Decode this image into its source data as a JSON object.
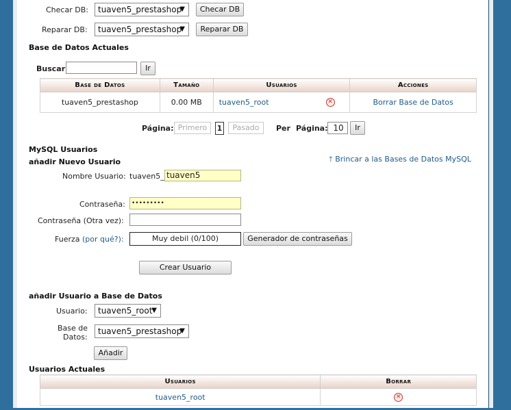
{
  "check_db": {
    "label": "Checar DB:",
    "selected": "tuaven5_prestashop",
    "button": "Checar DB"
  },
  "repair_db": {
    "label": "Reparar DB:",
    "selected": "tuaven5_prestashop",
    "button": "Reparar DB"
  },
  "current_dbs": {
    "title": "Base de Datos Actuales",
    "search_label": "Buscar",
    "search_value": "",
    "search_button": "Ir",
    "columns": [
      "Base de Datos",
      "Tamaño",
      "Usuarios",
      "Acciones"
    ],
    "rows": [
      {
        "name": "tuaven5_prestashop",
        "size": "0.00 MB",
        "user": "tuaven5_root",
        "action": "Borrar Base de Datos"
      }
    ]
  },
  "pagination": {
    "page_label": "Página:",
    "first": "Primero",
    "current": "1",
    "prev": "Pasado",
    "per_label": "Per",
    "per_page_label": "Página:",
    "per_page_value": "10",
    "go": "Ir"
  },
  "mysql_users": {
    "title": "MySQL Usuarios",
    "add_title": "añadir Nuevo Usuario",
    "jump_link": "Brincar a las Bases de Datos MySQL",
    "username_label": "Nombre Usuario:",
    "username_prefix": "tuaven5_",
    "username_value": "tuaven5",
    "password_label": "Contraseña:",
    "password_value": "•••••••••",
    "password_again_label": "Contraseña (Otra vez):",
    "password_again_value": "",
    "strength_label": "Fuerza",
    "strength_why": "(por qué?):",
    "strength_value": "Muy debil (0/100)",
    "generator_button": "Generador de contraseñas",
    "create_button": "Crear Usuario"
  },
  "add_user_db": {
    "title": "añadir Usuario a Base de Datos",
    "user_label": "Usuario:",
    "user_selected": "tuaven5_root",
    "db_label_line1": "Base de",
    "db_label_line2": "Datos:",
    "db_selected": "tuaven5_prestashop",
    "add_button": "Añadir"
  },
  "current_users": {
    "title": "Usuarios Actuales",
    "columns": [
      "Usuarios",
      "Borrar"
    ],
    "rows": [
      {
        "user": "tuaven5_root"
      }
    ]
  },
  "icons": {
    "delete": "delete-x-icon",
    "dropdown": "chevron-down-icon",
    "up": "up-arrow-icon"
  },
  "colors": {
    "frame": "#2f6f9e",
    "link": "#1e5a8a",
    "input_highlight": "#ffffc6"
  }
}
